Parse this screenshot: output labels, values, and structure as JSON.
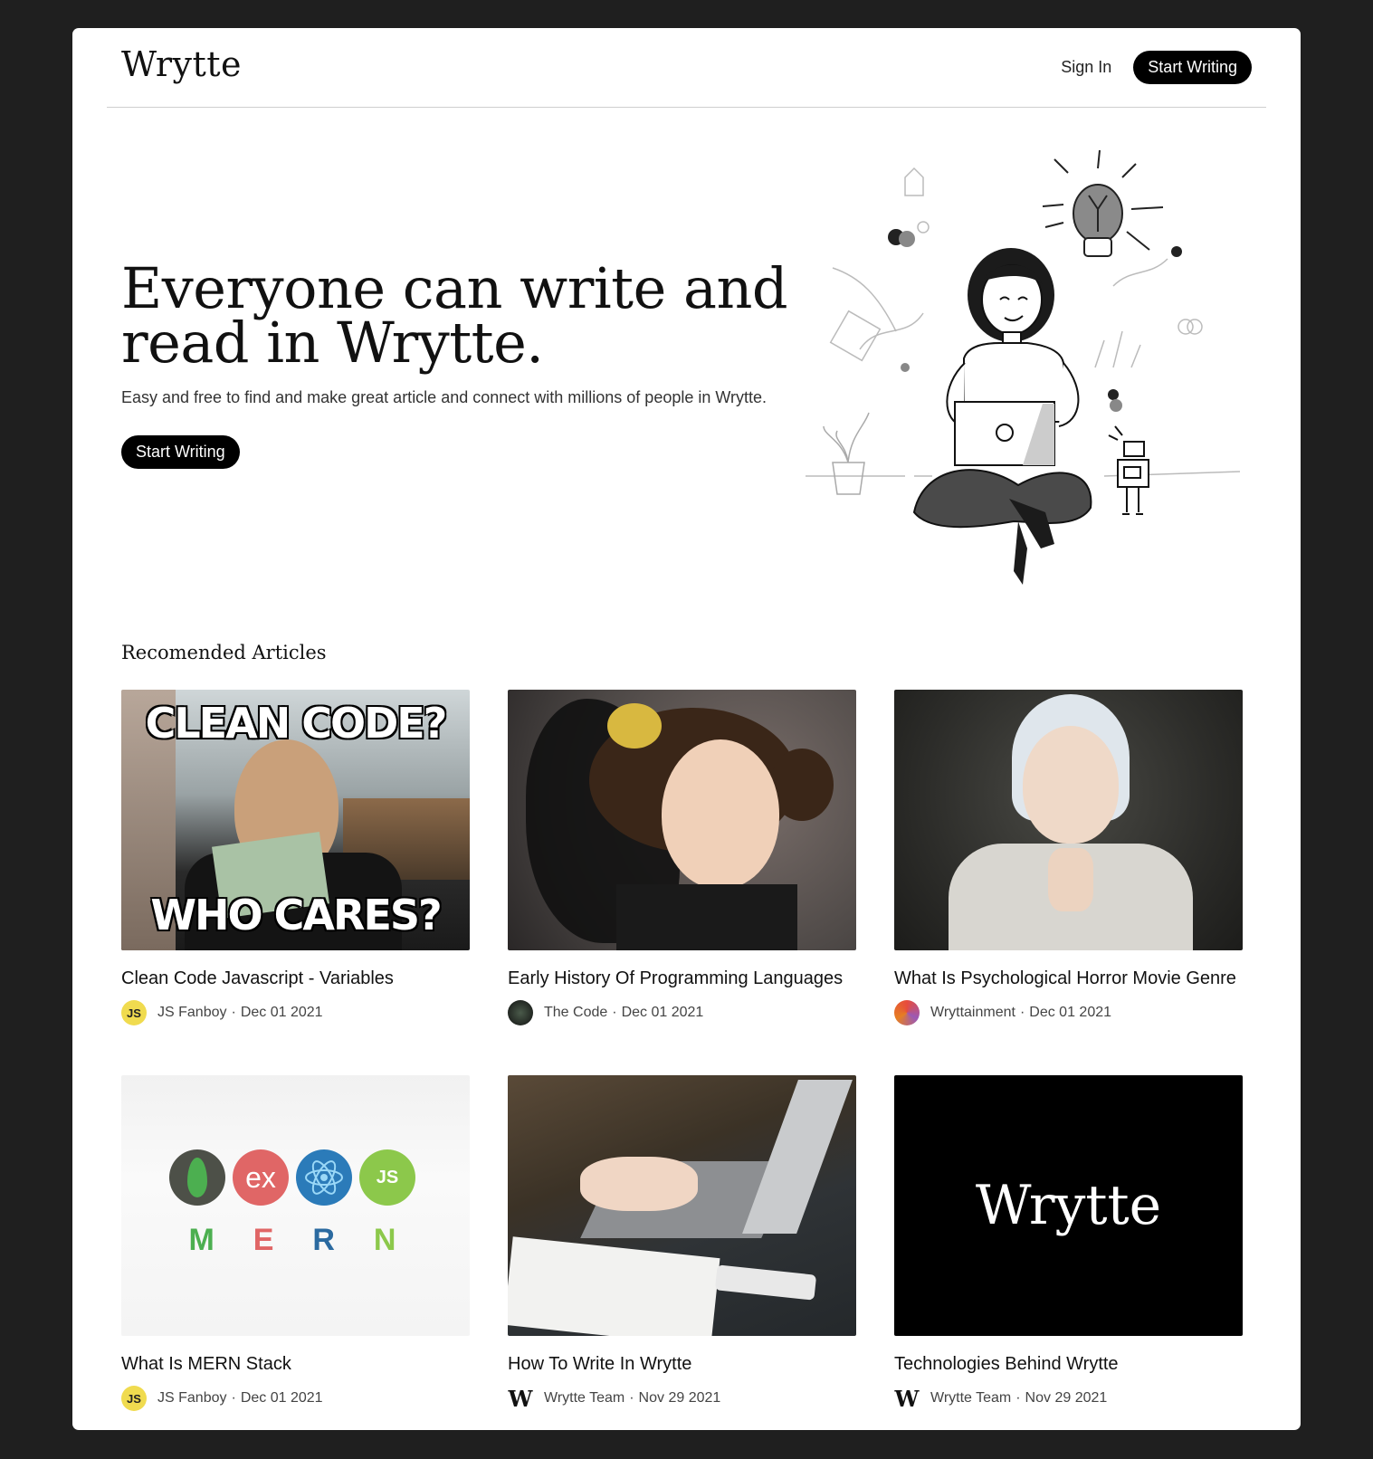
{
  "header": {
    "logo": "Wrytte",
    "sign_in": "Sign In",
    "start_writing": "Start Writing"
  },
  "hero": {
    "title_line1": "Everyone can write and",
    "title_line2": "read in Wrytte.",
    "subtitle": "Easy and free to find and make great article and connect with millions of people in Wrytte.",
    "cta": "Start Writing"
  },
  "section": {
    "title": "Recomended Articles"
  },
  "articles": [
    {
      "title": "Clean Code Javascript - Variables",
      "author": "JS Fanboy",
      "date": "Dec 01 2021",
      "avatar_text": "JS",
      "thumb_text_top": "CLEAN CODE?",
      "thumb_text_bottom": "WHO CARES?"
    },
    {
      "title": "Early History Of Programming Languages",
      "author": "The Code",
      "date": "Dec 01 2021"
    },
    {
      "title": "What Is Psychological Horror Movie Genre",
      "author": "Wryttainment",
      "date": "Dec 01 2021"
    },
    {
      "title": "What Is MERN Stack",
      "author": "JS Fanboy",
      "date": "Dec 01 2021",
      "avatar_text": "JS",
      "mern": [
        "M",
        "E",
        "R",
        "N"
      ],
      "ex_text": "ex",
      "js_text": "JS"
    },
    {
      "title": "How To Write In Wrytte",
      "author": "Wrytte Team",
      "date": "Nov 29 2021",
      "avatar_text": "W"
    },
    {
      "title": "Technologies Behind Wrytte",
      "author": "Wrytte Team",
      "date": "Nov 29 2021",
      "avatar_text": "W",
      "thumb_logo": "Wrytte"
    }
  ],
  "separator": "·",
  "colors": {
    "background": "#1f1f1f",
    "page": "#ffffff",
    "button": "#000000",
    "js_yellow": "#f0db4f",
    "mongo_green": "#4caf50",
    "express_red": "#e06666",
    "react_blue": "#2b7bb9",
    "node_green": "#8cc84b"
  },
  "icons": [
    "woman-with-laptop-illustration",
    "lightbulb-icon",
    "robot-icon",
    "plant-icon"
  ]
}
